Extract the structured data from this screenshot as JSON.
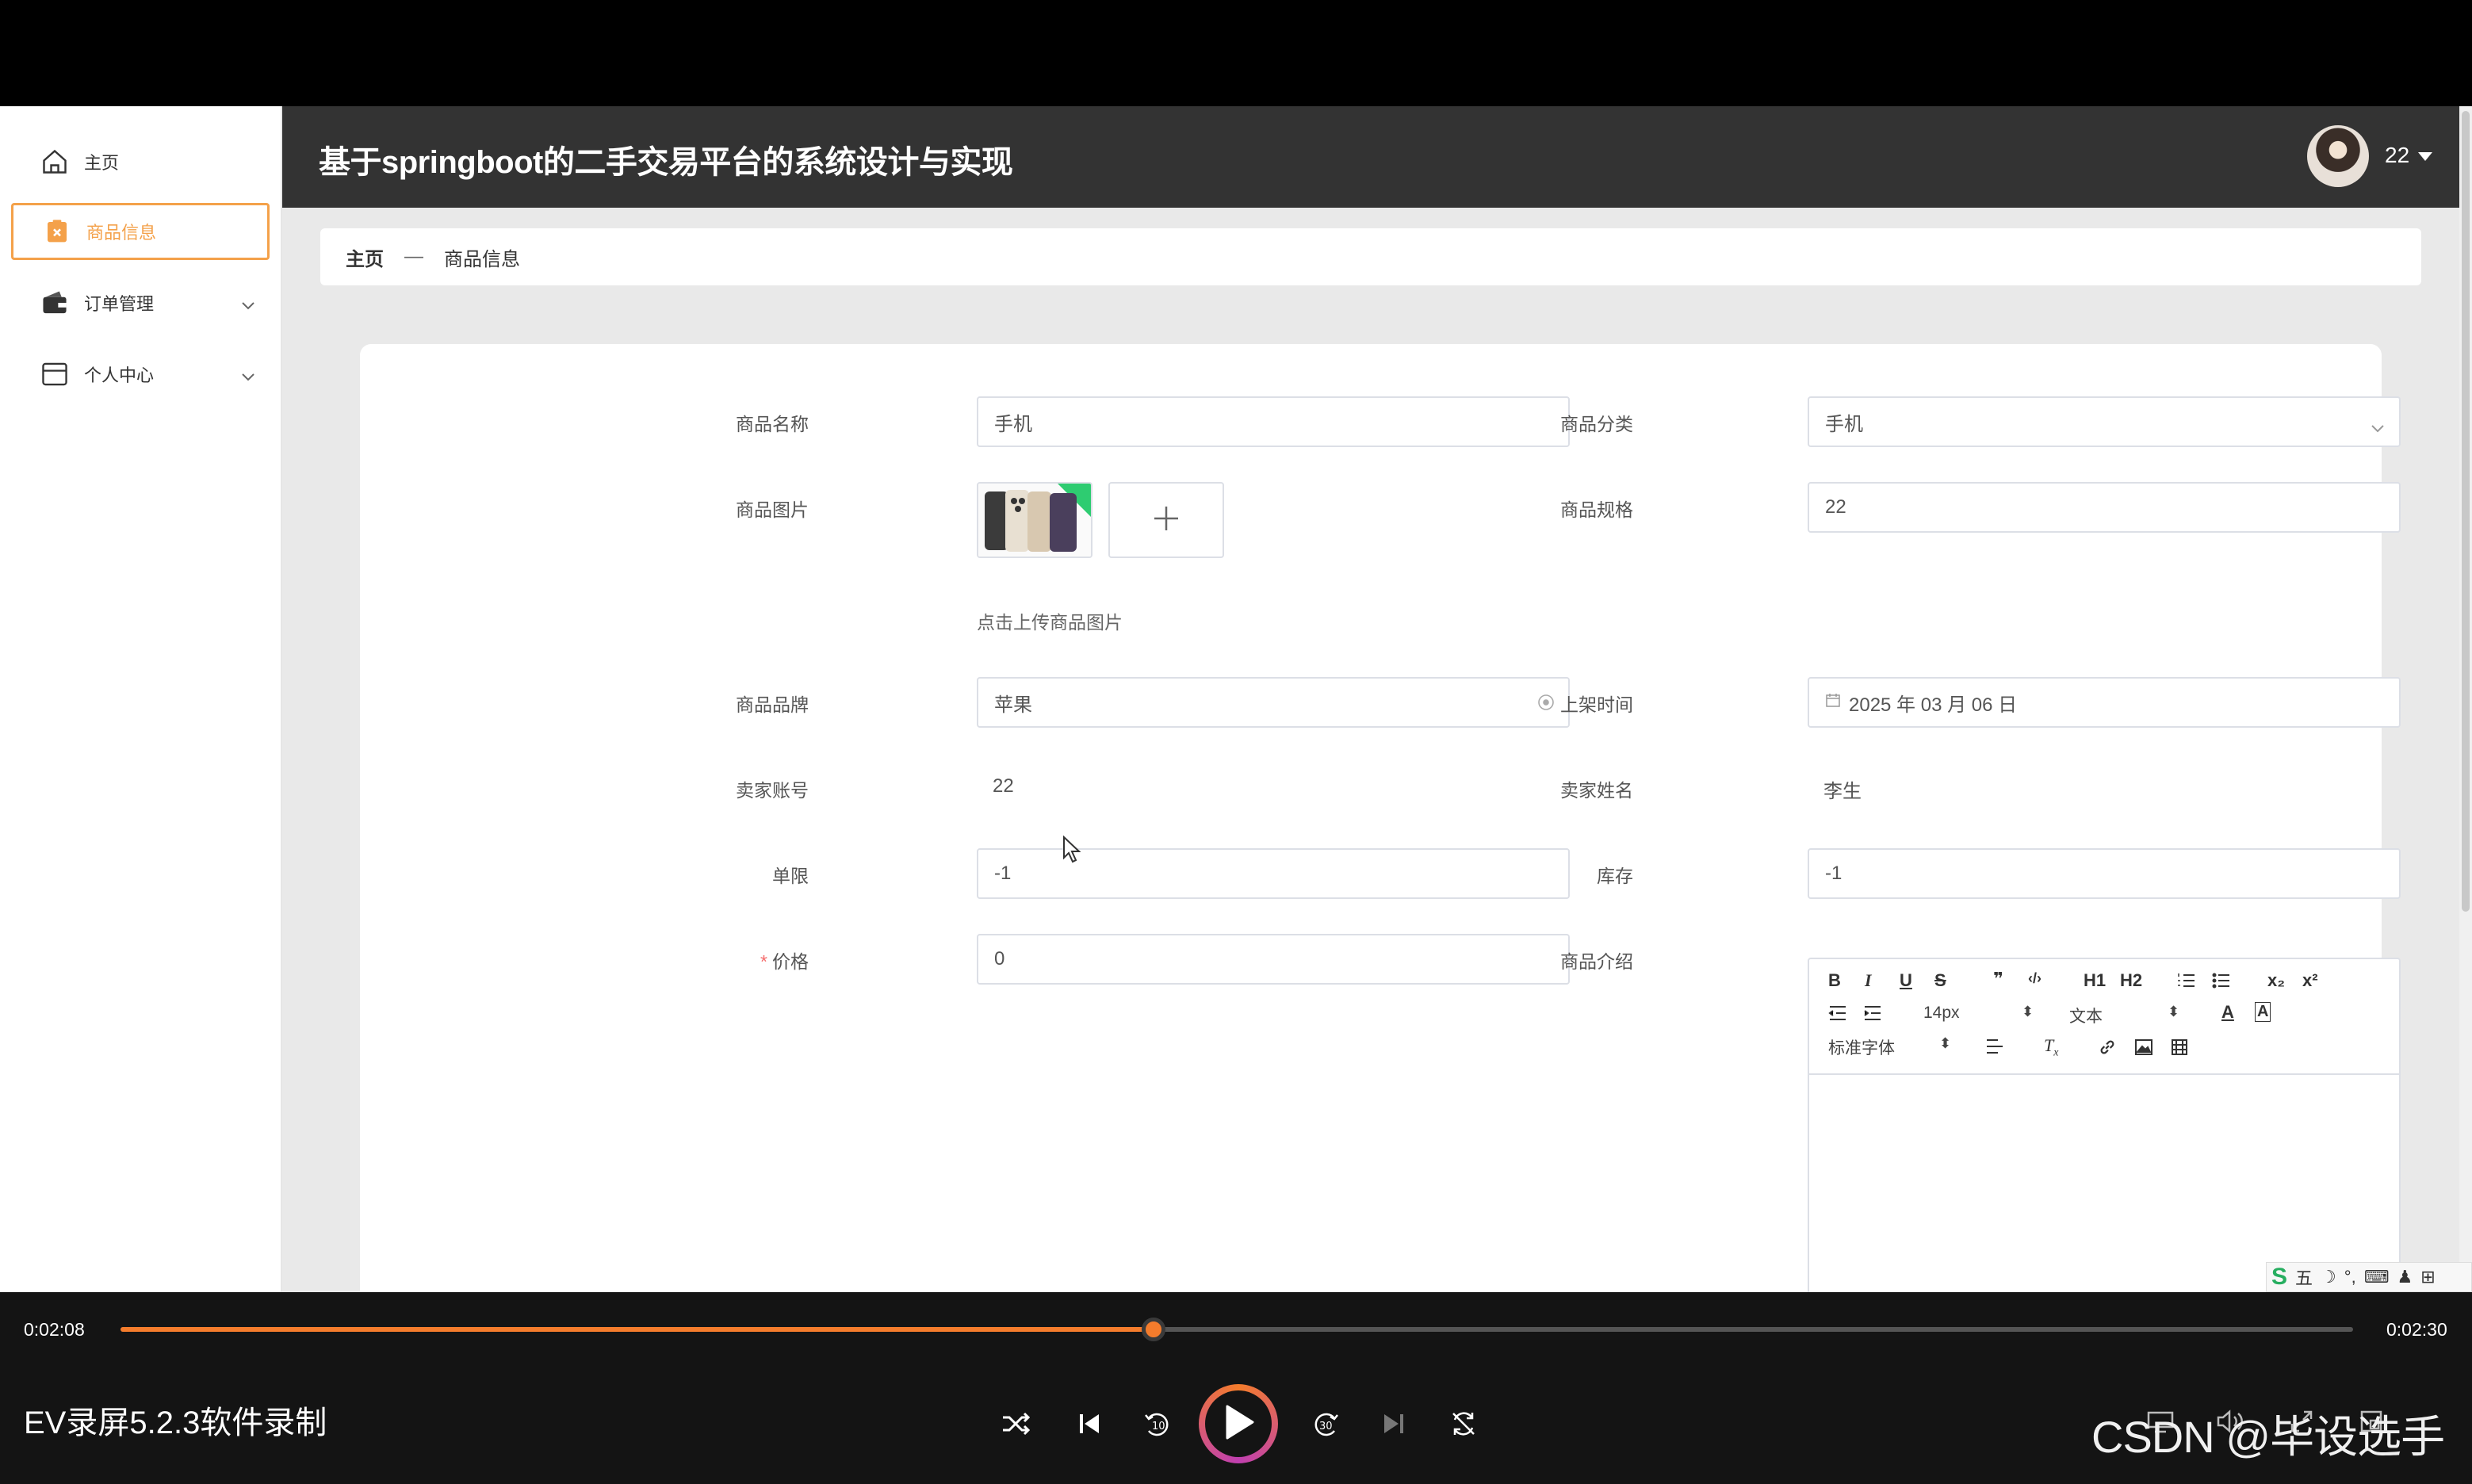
{
  "sidebar": {
    "items": [
      {
        "label": "主页",
        "icon": "home-icon"
      },
      {
        "label": "商品信息",
        "icon": "goods-icon",
        "active": true
      },
      {
        "label": "订单管理",
        "icon": "wallet-icon"
      },
      {
        "label": "个人中心",
        "icon": "card-icon"
      }
    ]
  },
  "header": {
    "title": "基于springboot的二手交易平台的系统设计与实现",
    "username": "22"
  },
  "breadcrumb": {
    "home": "主页",
    "separator": "—",
    "current": "商品信息"
  },
  "form": {
    "name_label": "商品名称",
    "name_value": "手机",
    "category_label": "商品分类",
    "category_value": "手机",
    "image_label": "商品图片",
    "upload_hint": "点击上传商品图片",
    "spec_label": "商品规格",
    "spec_value": "22",
    "brand_label": "商品品牌",
    "brand_value": "苹果",
    "shelf_time_label": "上架时间",
    "shelf_time_value": "2025 年 03 月 06 日",
    "seller_account_label": "卖家账号",
    "seller_account_value": "22",
    "seller_name_label": "卖家姓名",
    "seller_name_value": "李生",
    "limit_label": "单限",
    "limit_value": "-1",
    "stock_label": "库存",
    "stock_value": "-1",
    "price_label": "价格",
    "price_required": "*",
    "price_value": "0",
    "intro_label": "商品介绍"
  },
  "editor": {
    "font_size": "14px",
    "text_style": "文本",
    "font_family": "标准字体",
    "buttons": [
      "B",
      "I",
      "U",
      "S",
      "❞",
      "‹/›",
      "H1",
      "H2",
      "x₂",
      "x²"
    ]
  },
  "ime": {
    "mode": "五"
  },
  "player": {
    "current_time": "0:02:08",
    "total_time": "0:02:30",
    "progress": 0.4626,
    "recorder_label": "EV录屏5.2.3软件录制",
    "watermark": "CSDN @毕设选手"
  },
  "colors": {
    "accent": "#f4a14a",
    "header_bg": "#333333",
    "player_accent": "#f47c2c"
  }
}
